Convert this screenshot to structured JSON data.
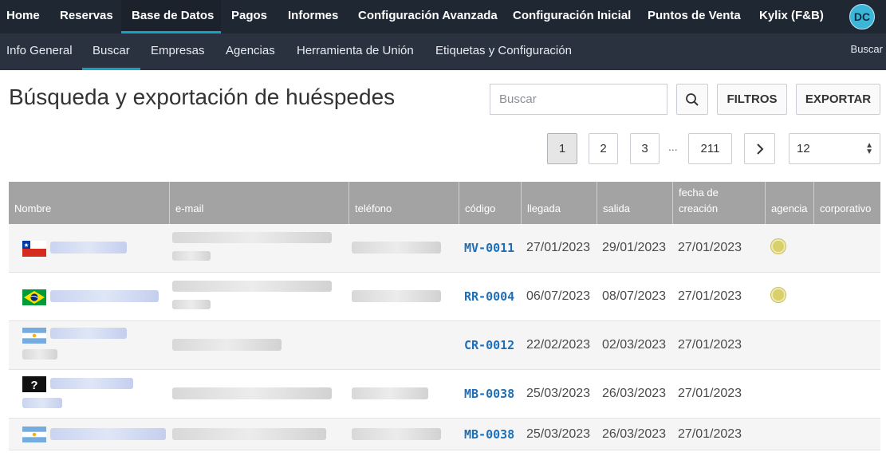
{
  "topnav": {
    "items": [
      {
        "label": "Home"
      },
      {
        "label": "Reservas"
      },
      {
        "label": "Base de Datos"
      },
      {
        "label": "Pagos"
      },
      {
        "label": "Informes"
      },
      {
        "label": "Configuración Avanzada"
      },
      {
        "label": "Configuración Inicial"
      },
      {
        "label": "Puntos de Venta"
      },
      {
        "label": "Kylix (F&B)"
      }
    ],
    "active": "Base de Datos",
    "avatar_initials": "DC"
  },
  "subnav": {
    "items": [
      {
        "label": "Info General"
      },
      {
        "label": "Buscar"
      },
      {
        "label": "Empresas"
      },
      {
        "label": "Agencias"
      },
      {
        "label": "Herramienta de Unión"
      },
      {
        "label": "Etiquetas y Configuración"
      }
    ],
    "active": "Buscar",
    "right_label": "Buscar"
  },
  "page": {
    "title": "Búsqueda y exportación de huéspedes",
    "search_placeholder": "Buscar",
    "filters_label": "FILTROS",
    "export_label": "EXPORTAR",
    "search_icon": "search-icon"
  },
  "pagination": {
    "pages": [
      "1",
      "2",
      "3"
    ],
    "current": "1",
    "ellipsis": "...",
    "last": "211",
    "next_icon": "chevron-right-icon",
    "page_size": "12"
  },
  "table": {
    "columns": [
      "Nombre",
      "e-mail",
      "teléfono",
      "código",
      "llegada",
      "salida",
      "fecha de creación",
      "agencia",
      "corporativo"
    ],
    "rows": [
      {
        "flag": "chile",
        "code": "MV-0011",
        "arrival": "27/01/2023",
        "departure": "29/01/2023",
        "created": "27/01/2023",
        "agency": true
      },
      {
        "flag": "brazil",
        "code": "RR-0004",
        "arrival": "06/07/2023",
        "departure": "08/07/2023",
        "created": "27/01/2023",
        "agency": true
      },
      {
        "flag": "argentina",
        "code": "CR-0012",
        "arrival": "22/02/2023",
        "departure": "02/03/2023",
        "created": "27/01/2023",
        "agency": false
      },
      {
        "flag": "unknown",
        "code": "MB-0038",
        "arrival": "25/03/2023",
        "departure": "26/03/2023",
        "created": "27/01/2023",
        "agency": false
      },
      {
        "flag": "argentina",
        "code": "MB-0038",
        "arrival": "25/03/2023",
        "departure": "26/03/2023",
        "created": "27/01/2023",
        "agency": false
      }
    ]
  },
  "colors": {
    "topnav_bg": "#1f2733",
    "subnav_bg": "#2a323f",
    "accent": "#17a2c4",
    "code_link": "#1e6fb8",
    "table_header_bg": "#a3a3a3"
  }
}
